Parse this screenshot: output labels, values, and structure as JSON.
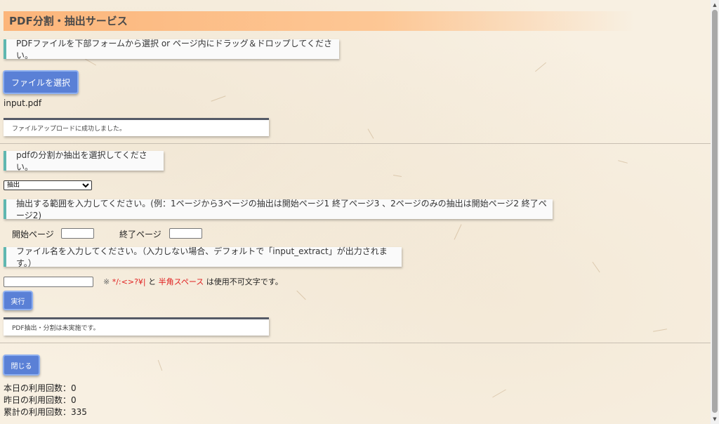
{
  "header": {
    "title": "PDF分割・抽出サービス"
  },
  "upload": {
    "instruction": "PDFファイルを下部フォームから選択 or ページ内にドラッグ＆ドロップしてください。",
    "select_button": "ファイルを選択",
    "filename": "input.pdf",
    "status": "ファイルアップロードに成功しました。"
  },
  "mode": {
    "instruction": "pdfの分割か抽出を選択してください。",
    "selected": "抽出"
  },
  "range": {
    "instruction": "抽出する範囲を入力してください。(例：1ページから3ページの抽出は開始ページ1 終了ページ3 、2ページのみの抽出は開始ページ2 終了ページ2)",
    "start_label": "開始ページ",
    "start_value": "",
    "end_label": "終了ページ",
    "end_value": ""
  },
  "filename_input": {
    "instruction": "ファイル名を入力してください。（入力しない場合、デフォルトで「input_extract」が出力されます。）",
    "value": "",
    "note_prefix": "※ ",
    "note_chars": "*/:<>?¥|",
    "note_and": " と ",
    "note_space": "半角スペース",
    "note_suffix": " は使用不可文字です。"
  },
  "execute": {
    "button": "実行",
    "status": "PDF抽出・分割は未実施です。"
  },
  "footer": {
    "close_button": "閉じる",
    "today_label": "本日の利用回数：",
    "today_value": "0",
    "yesterday_label": "昨日の利用回数：",
    "yesterday_value": "0",
    "total_label": "累計の利用回数：",
    "total_value": "335"
  },
  "colors": {
    "accent_bar": "#5fb7b0",
    "button": "#5a80d6",
    "title_gradient": "#fcb57a",
    "warning": "#e02020"
  },
  "icons": {
    "scroll_up": "scroll-up-arrow-icon",
    "scroll_down": "scroll-down-arrow-icon"
  }
}
